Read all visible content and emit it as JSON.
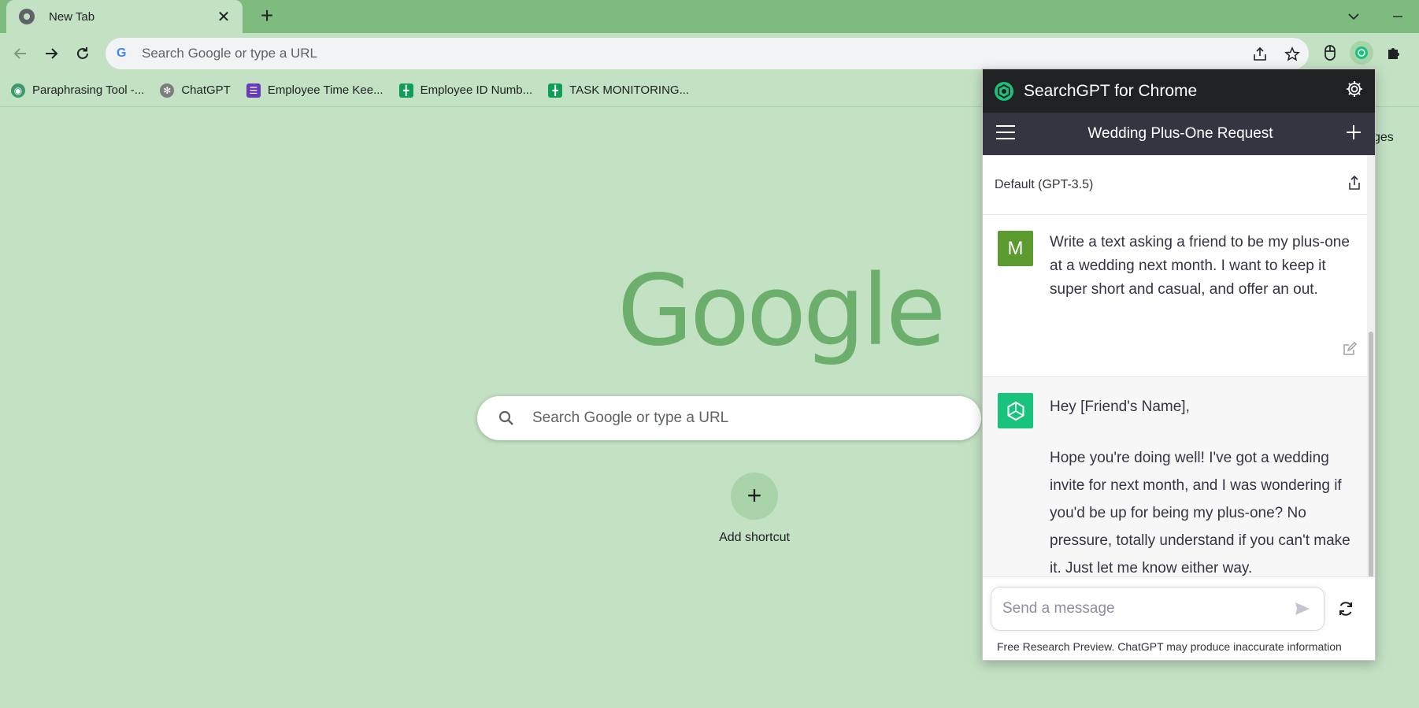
{
  "browser": {
    "tab": {
      "title": "New Tab",
      "close": "✕"
    },
    "new_tab": "+",
    "omnibox": {
      "placeholder": "Search Google or type a URL",
      "g_letter": "G"
    },
    "bookmarks": [
      {
        "label": "Paraphrasing Tool -...",
        "icon": "robot-icon",
        "color": "#3c9a6a"
      },
      {
        "label": "ChatGPT",
        "icon": "openai-icon",
        "color": "#7d7d7d"
      },
      {
        "label": "Employee Time Kee...",
        "icon": "forms-icon",
        "color": "#673ab7"
      },
      {
        "label": "Employee ID Numb...",
        "icon": "sheets-icon",
        "color": "#0f9d58"
      },
      {
        "label": "TASK MONITORING...",
        "icon": "sheets-icon",
        "color": "#0f9d58"
      }
    ]
  },
  "ntp": {
    "logo": "Google",
    "search_placeholder": "Search Google or type a URL",
    "shortcut_label": "Add shortcut",
    "shortcut_glyph": "+",
    "partial_text": "ges"
  },
  "popup": {
    "title": "SearchGPT for Chrome",
    "chat_title": "Wedding Plus-One Request",
    "new_chat": "+",
    "model": "Default (GPT-3.5)",
    "user_avatar": "M",
    "user_message": "Write a text asking a friend to be my plus-one at a wedding next month. I want to keep it super short and casual, and offer an out.",
    "bot_greeting": "Hey [Friend's Name],",
    "bot_body": "Hope you're doing well! I've got a wedding invite for next month, and I was wondering if you'd be up for being my plus-one? No pressure, totally understand if you can't make it. Just let me know either way.",
    "input_placeholder": "Send a message",
    "footer": "Free Research Preview. ChatGPT may produce inaccurate information"
  },
  "colors": {
    "tabstrip": "#7ebb7e",
    "page_bg": "#c3e1c3",
    "google_logo": "#6cae6c",
    "popup_header": "#202123",
    "chat_bar": "#343541",
    "user_avatar": "#5a9a2f",
    "bot_avatar": "#19c37d"
  }
}
